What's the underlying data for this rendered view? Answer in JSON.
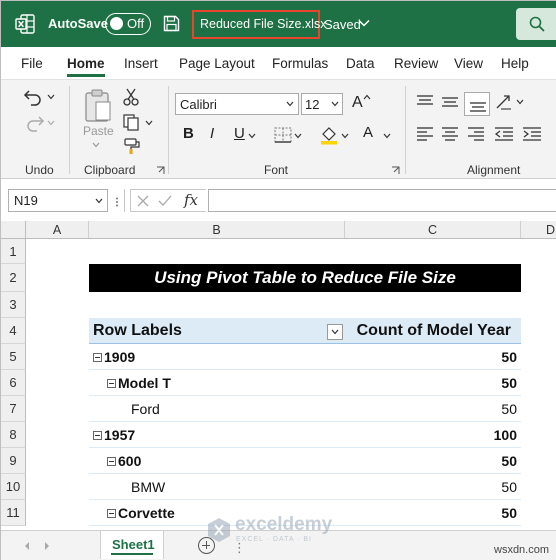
{
  "titlebar": {
    "autosave_label": "AutoSave",
    "toggle_state": "Off",
    "filename": "Reduced File Size.xlsx",
    "saved_status": "Saved"
  },
  "menu": {
    "tabs": [
      "File",
      "Home",
      "Insert",
      "Page Layout",
      "Formulas",
      "Data",
      "Review",
      "View",
      "Help"
    ],
    "active": "Home"
  },
  "ribbon": {
    "groups": [
      "Undo",
      "Clipboard",
      "Font",
      "Alignment"
    ],
    "paste_label": "Paste",
    "font_name": "Calibri",
    "font_size": "12",
    "bold_label": "B",
    "italic_label": "I",
    "underline_label": "U",
    "font_color_letter": "A",
    "grow_font_letter": "A"
  },
  "formula_bar": {
    "name_box": "N19",
    "fx_label": "fx",
    "formula_value": ""
  },
  "grid": {
    "columns": [
      "A",
      "B",
      "C",
      "D"
    ],
    "rows": [
      "1",
      "2",
      "3",
      "4",
      "5",
      "6",
      "7",
      "8",
      "9",
      "10",
      "11"
    ],
    "title": "Using Pivot Table to Reduce File Size",
    "pivot_header": {
      "row_labels": "Row Labels",
      "value_header": "Count of Model Year"
    },
    "pivot_rows": [
      {
        "label": "1909",
        "value": "50",
        "level": 0,
        "bold": true,
        "collapsible": true
      },
      {
        "label": "Model T",
        "value": "50",
        "level": 1,
        "bold": true,
        "collapsible": true
      },
      {
        "label": "Ford",
        "value": "50",
        "level": 2,
        "bold": false,
        "collapsible": false
      },
      {
        "label": "1957",
        "value": "100",
        "level": 0,
        "bold": true,
        "collapsible": true
      },
      {
        "label": "600",
        "value": "50",
        "level": 1,
        "bold": true,
        "collapsible": true
      },
      {
        "label": "BMW",
        "value": "50",
        "level": 2,
        "bold": false,
        "collapsible": false
      },
      {
        "label": "Corvette",
        "value": "50",
        "level": 1,
        "bold": true,
        "collapsible": true
      }
    ]
  },
  "sheets": {
    "tabs": [
      "Sheet1"
    ],
    "active": "Sheet1"
  },
  "watermark": {
    "brand": "exceldemy",
    "tagline": "EXCEL · DATA · BI"
  },
  "site_mark": "wsxdn.com",
  "colors": {
    "excel_green": "#1e7145",
    "pivot_header_bg": "#ddebf7",
    "highlight_box": "#e8442e"
  }
}
